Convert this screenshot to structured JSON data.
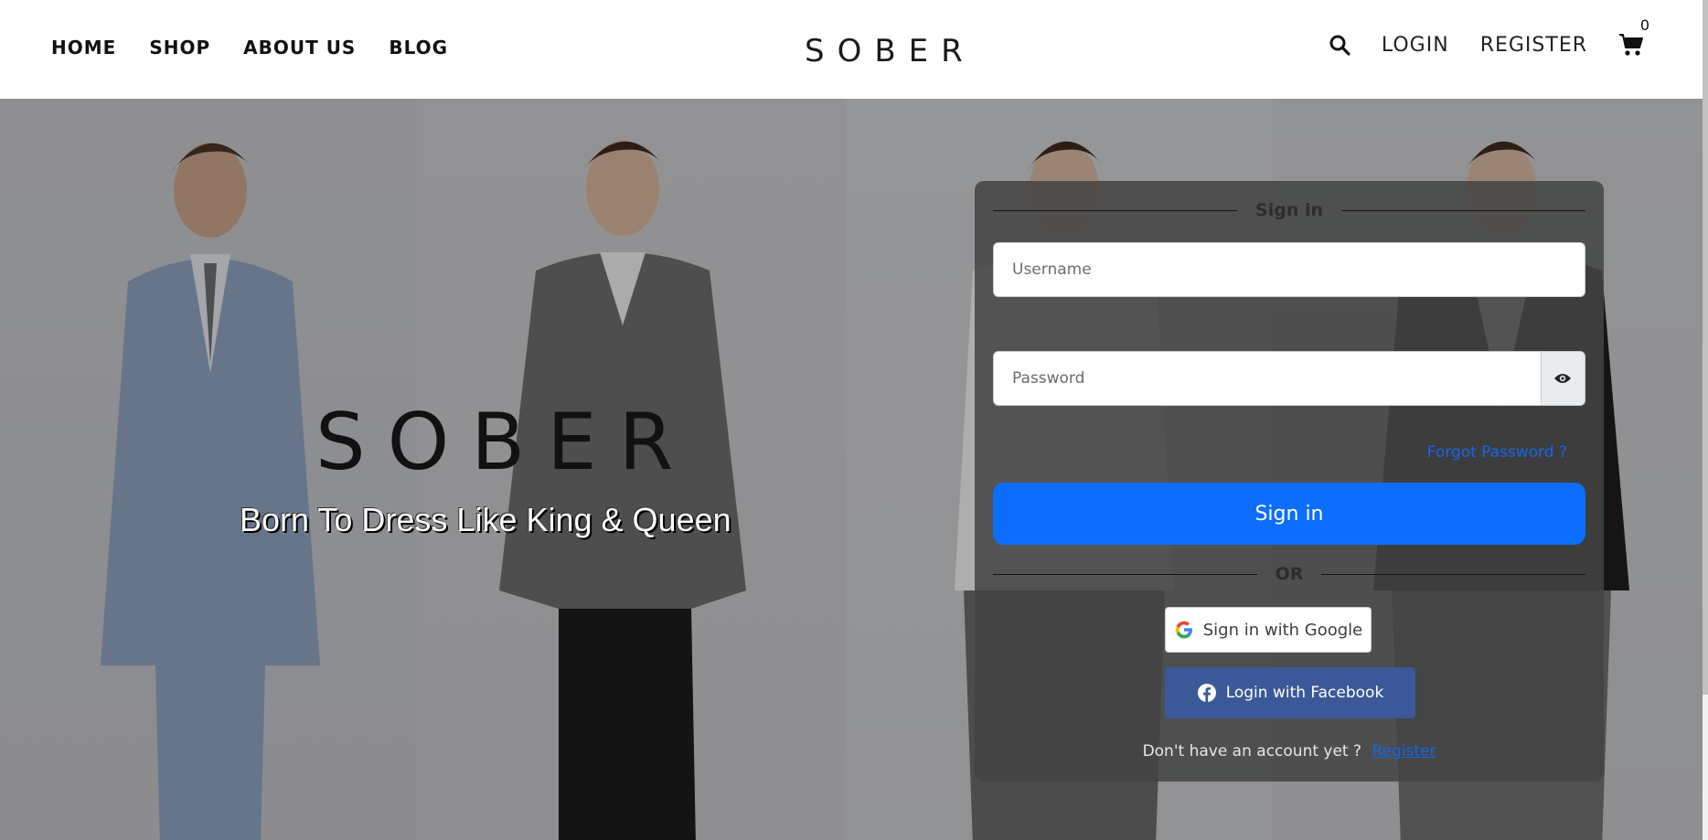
{
  "header": {
    "nav": [
      "HOME",
      "SHOP",
      "ABOUT US",
      "BLOG"
    ],
    "logo": "SOBER",
    "login": "LOGIN",
    "register": "REGISTER",
    "cart_count": "0"
  },
  "hero": {
    "brand": "SOBER",
    "tagline": "Born To Dress Like King & Queen"
  },
  "signin": {
    "heading": "Sign in",
    "username_placeholder": "Username",
    "password_placeholder": "Password",
    "forgot": "Forgot Password ?",
    "button": "Sign in",
    "or": "OR",
    "google": "Sign in with Google",
    "facebook": "Login with Facebook",
    "no_account": "Don't have an account yet ?",
    "register_link": "Register"
  },
  "colors": {
    "primary": "#0d6efd",
    "facebook": "#3b5998",
    "link": "#1565e8"
  }
}
